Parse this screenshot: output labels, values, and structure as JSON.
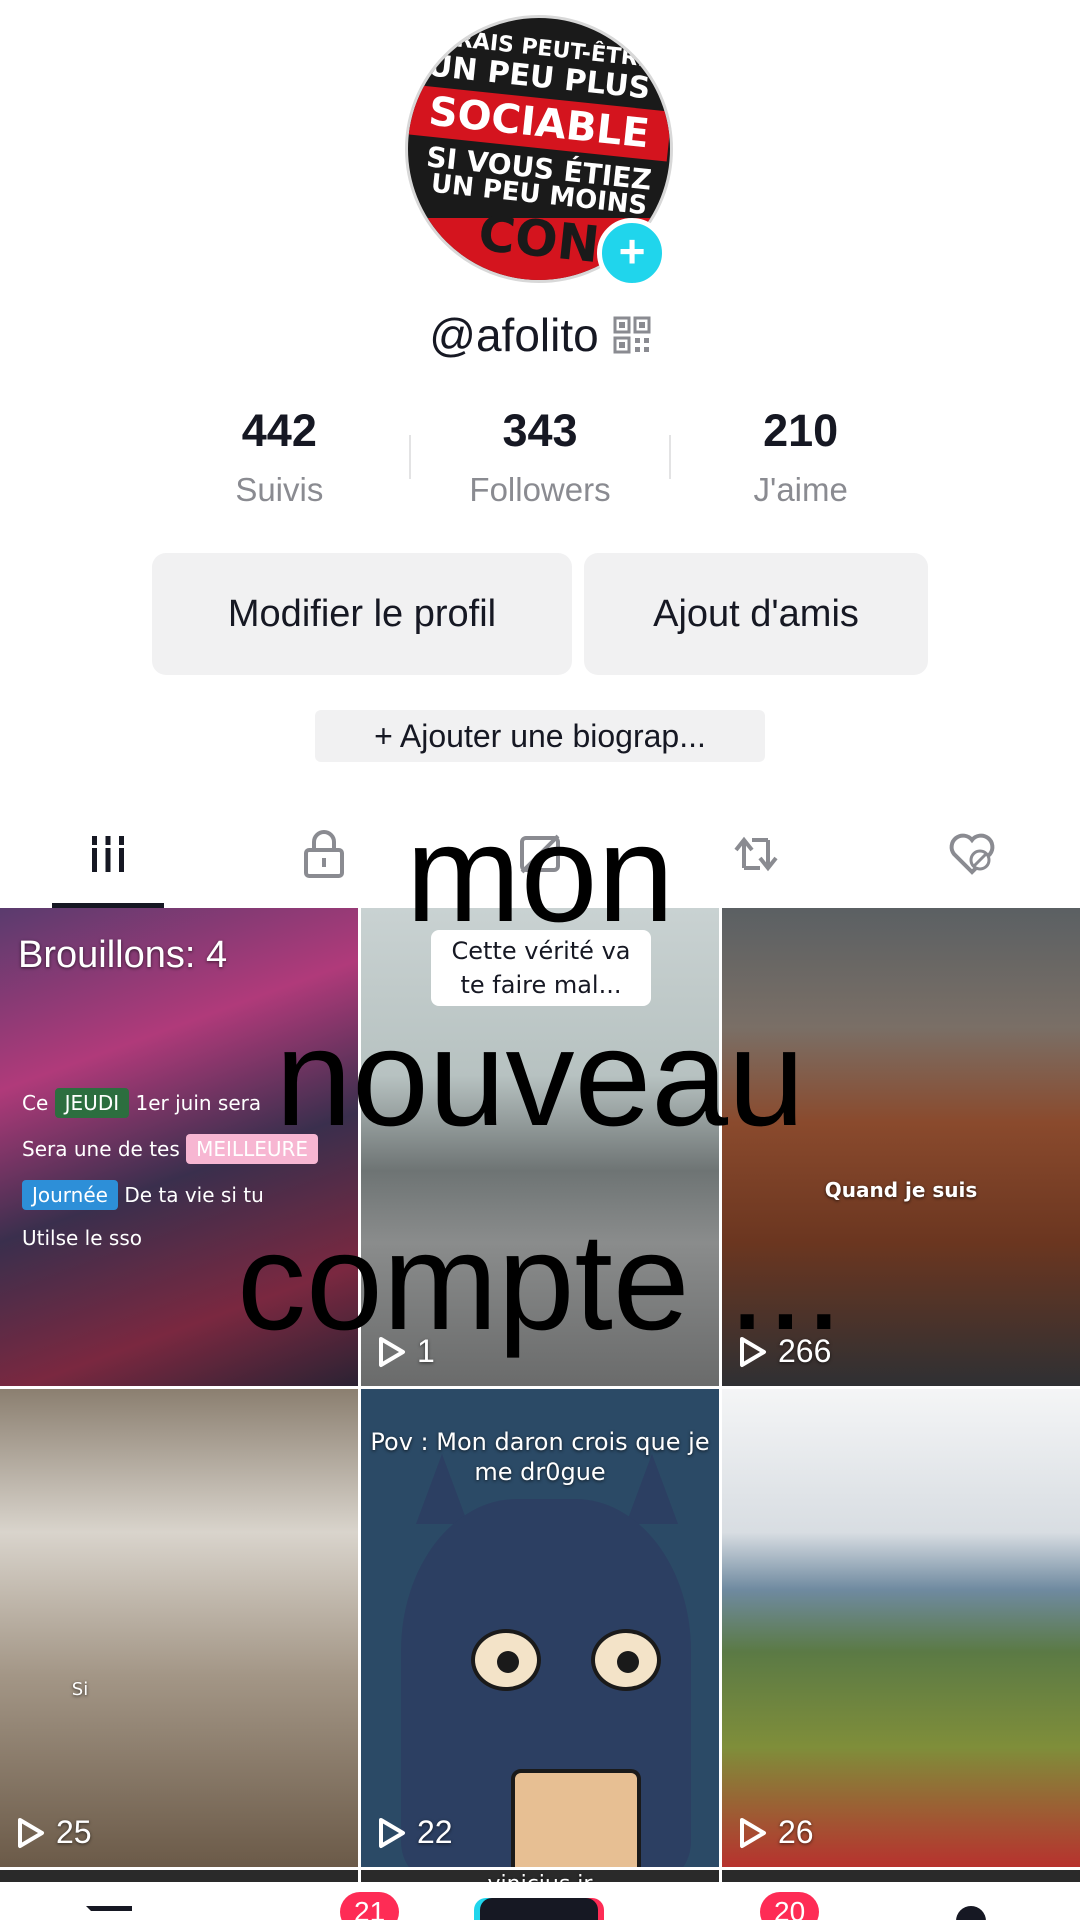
{
  "profile": {
    "avatar_text": [
      "SERAIS PEUT-ÊTRE",
      "UN PEU PLUS",
      "SOCIABLE",
      "SI VOUS ÉTIEZ",
      "UN PEU MOINS",
      "CON"
    ],
    "username": "@afolito"
  },
  "stats": [
    {
      "value": "442",
      "label": "Suivis"
    },
    {
      "value": "343",
      "label": "Followers"
    },
    {
      "value": "210",
      "label": "J'aime"
    }
  ],
  "actions": {
    "edit_profile": "Modifier le profil",
    "add_friends": "Ajout d'amis",
    "add_bio": "+ Ajouter une biograp..."
  },
  "tabs": [
    {
      "icon": "grid-icon",
      "active": true
    },
    {
      "icon": "lock-icon",
      "active": false
    },
    {
      "icon": "hidden-video-icon",
      "active": false
    },
    {
      "icon": "repost-icon",
      "active": false
    },
    {
      "icon": "liked-hidden-icon",
      "active": false
    }
  ],
  "overlay_text": {
    "line1": "mon",
    "line2": "nouveau",
    "line3": "compte ..."
  },
  "videos": [
    {
      "drafts_label": "Brouillons: 4",
      "lines": {
        "a1": "Ce",
        "a2": "JEUDI",
        "a3": "1er juin sera",
        "b1": "Sera une de tes",
        "b2": "MEILLEURE",
        "c1": "Journée",
        "c2": "De ta vie si tu",
        "d1": "Utilse le sso"
      }
    },
    {
      "caption": "Cette vérité va te faire mal...",
      "views": "1"
    },
    {
      "caption": "Quand je suis",
      "views": "266"
    },
    {
      "caption": "Si",
      "views": "25"
    },
    {
      "caption": "Pov : Mon daron crois que je me dr0gue",
      "views": "22"
    },
    {
      "views": "26"
    },
    {
      "caption": ""
    },
    {
      "caption": "vinicius jr"
    },
    {
      "caption": ""
    }
  ],
  "bottom_nav": {
    "friends_badge": "21",
    "inbox_badge": "20"
  },
  "colors": {
    "accent_cyan": "#20d5ec",
    "accent_red": "#fe2c55",
    "text_primary": "#161823",
    "text_secondary": "#8a8b91",
    "button_bg": "#f1f1f2"
  }
}
